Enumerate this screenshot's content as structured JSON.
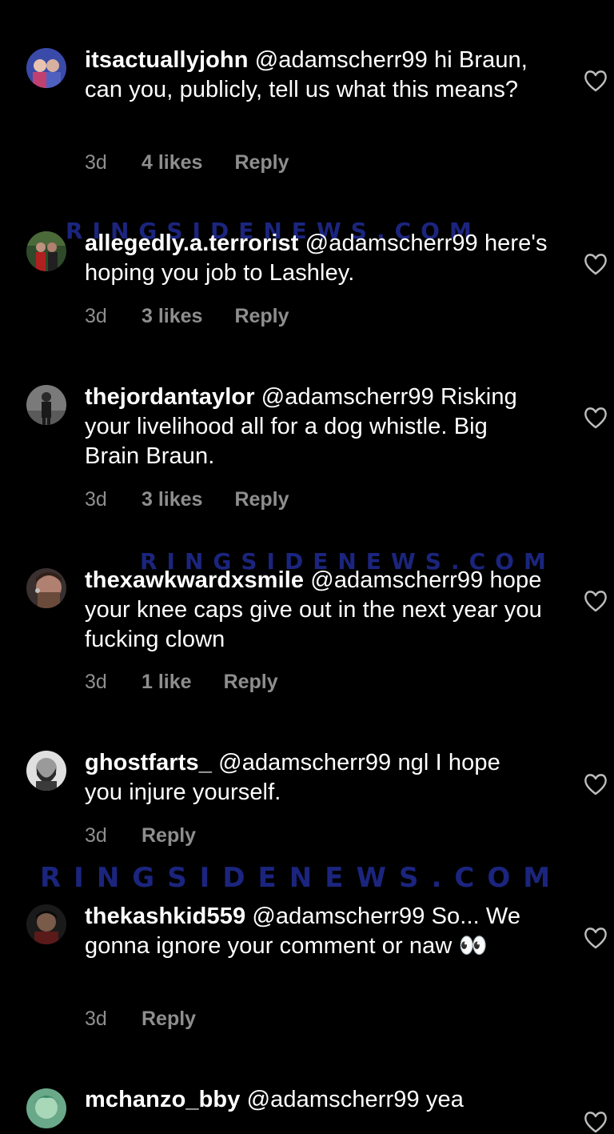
{
  "watermark": "RINGSIDENEWS.COM",
  "colors": {
    "background": "#000000",
    "text": "#ffffff",
    "meta": "#8e8e8e",
    "watermark": "#1e2a8c"
  },
  "comments": [
    {
      "username": "itsactuallyjohn",
      "text": " @adamscherr99 hi Braun, can you, publicly, tell us what this means?",
      "time": "3d",
      "likes": "4 likes",
      "reply": "Reply"
    },
    {
      "username": "allegedly.a.terrorist",
      "text": " @adamscherr99 here's hoping you job to Lashley.",
      "time": "3d",
      "likes": "3 likes",
      "reply": "Reply"
    },
    {
      "username": "thejordantaylor",
      "text": " @adamscherr99 Risking your livelihood all for a dog whistle. Big Brain Braun.",
      "time": "3d",
      "likes": "3 likes",
      "reply": "Reply"
    },
    {
      "username": "thexawkwardxsmile",
      "text": " @adamscherr99 hope your knee caps give out in the next year you fucking clown",
      "time": "3d",
      "likes": "1 like",
      "reply": "Reply"
    },
    {
      "username": "ghostfarts_",
      "text": " @adamscherr99 ngl I hope you injure yourself.",
      "time": "3d",
      "likes": "",
      "reply": "Reply"
    },
    {
      "username": "thekashkid559",
      "text": " @adamscherr99 So... We gonna ignore your comment or naw 👀",
      "time": "3d",
      "likes": "",
      "reply": "Reply"
    },
    {
      "username": "mchanzo_bby",
      "text": " @adamscherr99 yea",
      "time": "",
      "likes": "",
      "reply": ""
    }
  ]
}
